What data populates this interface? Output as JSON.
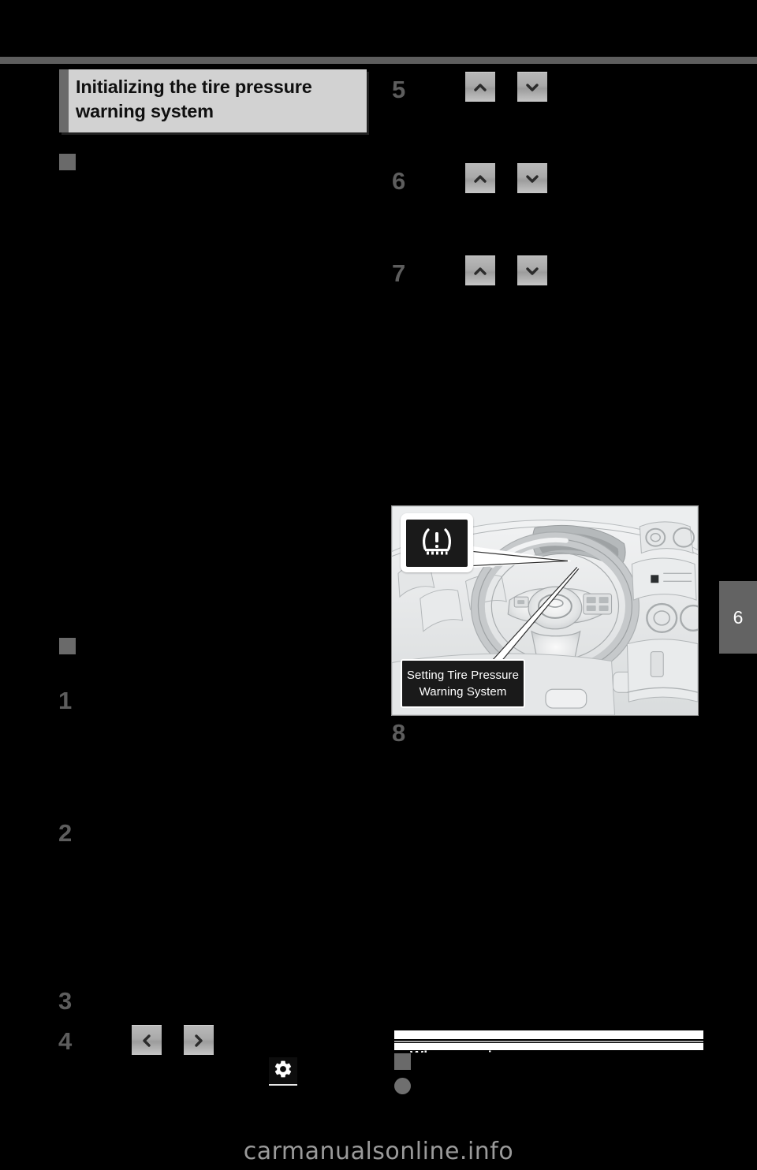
{
  "page": {
    "background_color": "#000000",
    "rule_color": "#5e5e5e",
    "watermark": "carmanualsonline.info"
  },
  "chapter_tab": {
    "number": "6"
  },
  "section": {
    "title_line1": "Initializing the tire pressure",
    "title_line2": "warning system",
    "title_bg": "#d2d2d2",
    "title_accent": "#6a6a6a"
  },
  "left_column": {
    "bullets": [
      {
        "name": "subsection-bullet-1",
        "shape": "square"
      },
      {
        "name": "subsection-bullet-2",
        "shape": "square"
      }
    ],
    "steps": [
      {
        "number": "1"
      },
      {
        "number": "2"
      },
      {
        "number": "3"
      },
      {
        "number": "4"
      }
    ],
    "step4_buttons": [
      {
        "icon": "chevron-left-icon",
        "label": "<"
      },
      {
        "icon": "chevron-right-icon",
        "label": ">"
      }
    ],
    "settings_icon": {
      "icon": "gear-icon",
      "color": "#ffffff",
      "bg": "#0d0d0d"
    }
  },
  "right_column": {
    "steps": [
      {
        "number": "5",
        "buttons": [
          {
            "icon": "chevron-up-icon"
          },
          {
            "icon": "chevron-down-icon"
          }
        ]
      },
      {
        "number": "6",
        "buttons": [
          {
            "icon": "chevron-up-icon"
          },
          {
            "icon": "chevron-down-icon"
          }
        ]
      },
      {
        "number": "7",
        "buttons": [
          {
            "icon": "chevron-up-icon"
          },
          {
            "icon": "chevron-down-icon"
          }
        ]
      },
      {
        "number": "8",
        "buttons": []
      }
    ],
    "figure": {
      "name": "instrument-panel-illustration",
      "tpms_indicator": {
        "icon": "tire-pressure-warning-icon",
        "bg": "#1a1a1a",
        "fg": "#ffffff"
      },
      "display_caption_line1": "Setting Tire Pressure",
      "display_caption_line2": "Warning System"
    },
    "notice": {
      "bullet_square": {
        "shape": "square"
      },
      "bullet_round": {
        "shape": "circle"
      },
      "heading_redacted": "When warning"
    }
  }
}
